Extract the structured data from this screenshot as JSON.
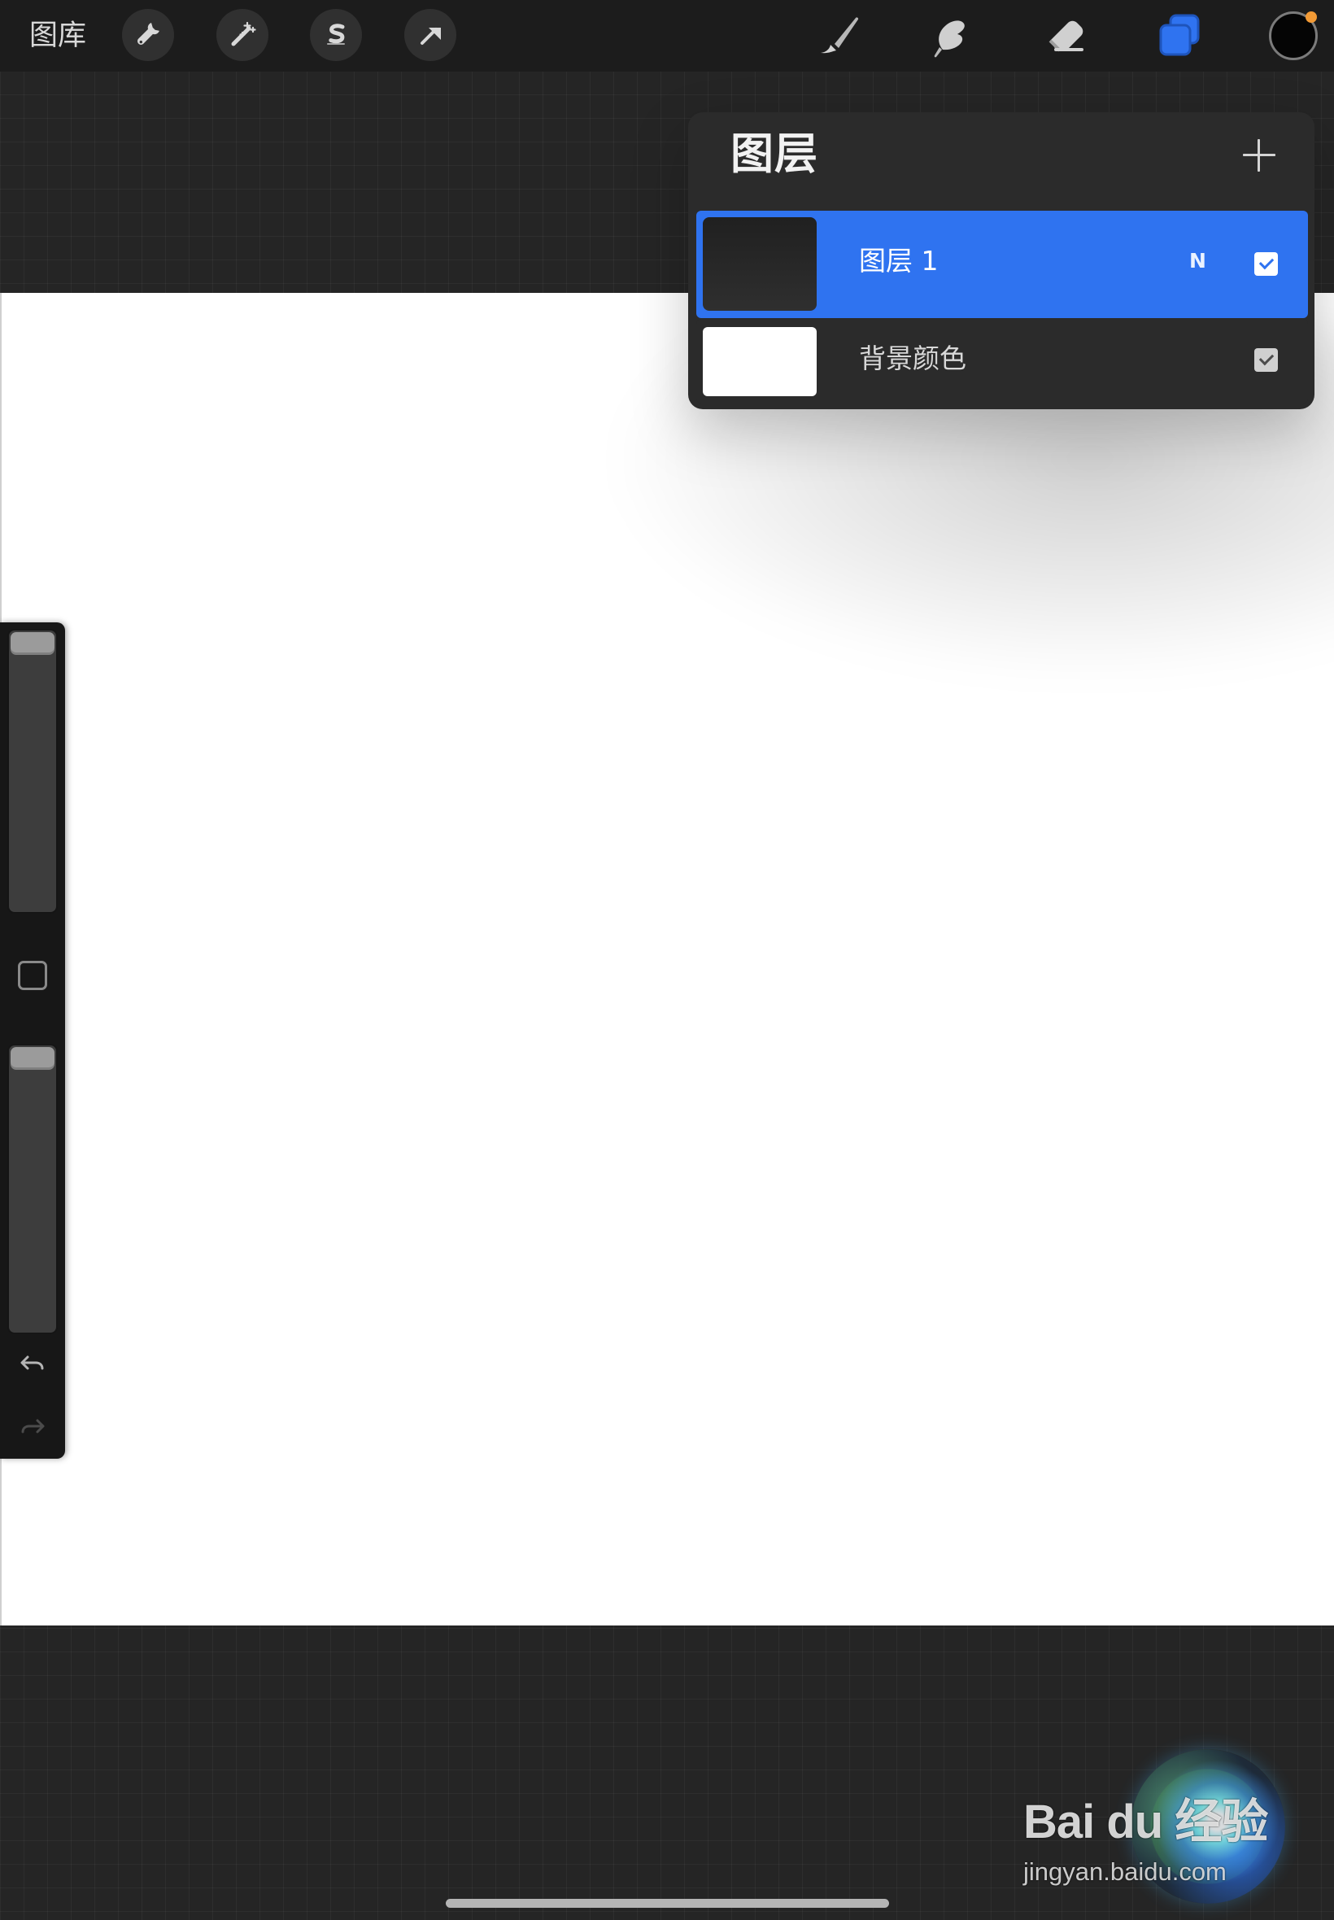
{
  "toolbar": {
    "gallery_label": "图库",
    "left_tools": [
      {
        "icon": "wrench-icon"
      },
      {
        "icon": "magic-wand-icon"
      },
      {
        "icon": "selection-s-icon"
      },
      {
        "icon": "move-arrow-icon"
      }
    ],
    "right_tools": [
      {
        "icon": "brush-icon"
      },
      {
        "icon": "smudge-icon"
      },
      {
        "icon": "eraser-icon"
      },
      {
        "icon": "layers-icon"
      }
    ],
    "current_color": "#050505",
    "color_indicator": "#f29a35"
  },
  "layers_panel": {
    "title": "图层",
    "add_icon": "plus-icon",
    "selected_color": "#2f73f0",
    "layers": [
      {
        "name": "图层 1",
        "blend_mode": "N",
        "visible": true,
        "selected": true,
        "thumbnail_color": "#252525"
      },
      {
        "name": "背景颜色",
        "blend_mode": "",
        "visible": true,
        "selected": false,
        "thumbnail_color": "#ffffff"
      }
    ]
  },
  "side_toolbar": {
    "undo_icon": "undo-icon",
    "redo_icon": "redo-icon",
    "modify_icon": "square-icon"
  },
  "watermark": {
    "brand": "Bai du 经验",
    "site": "jingyan.baidu.com"
  }
}
